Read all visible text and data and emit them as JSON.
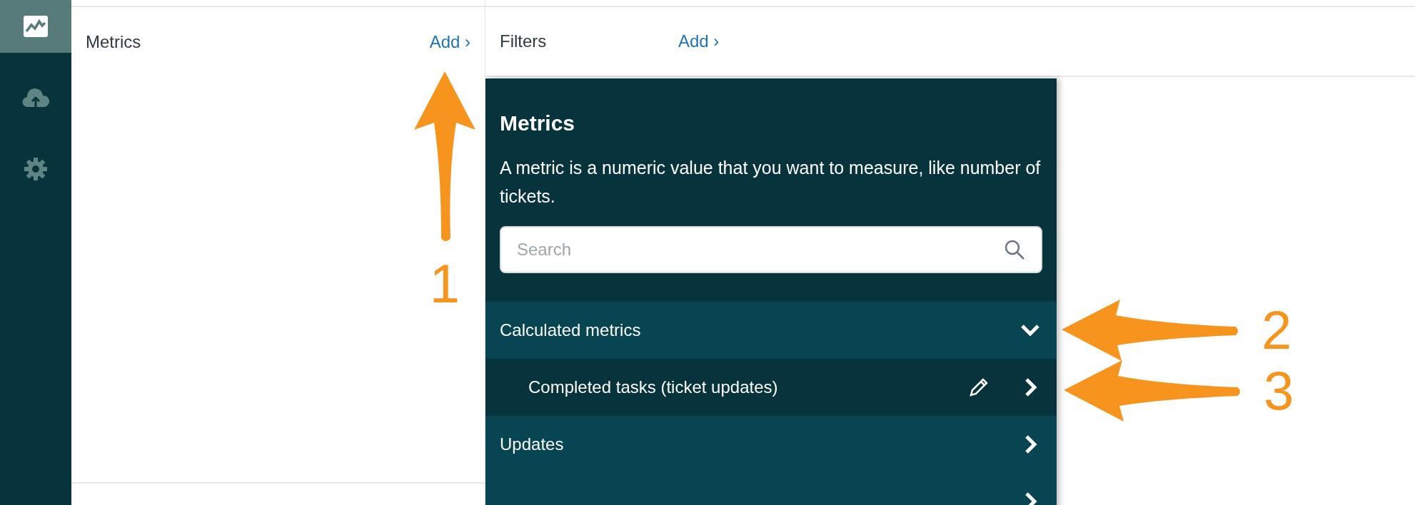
{
  "sidebar": {
    "items": [
      {
        "kind": "chart",
        "selected": true
      },
      {
        "kind": "upload",
        "selected": false
      },
      {
        "kind": "settings",
        "selected": false
      }
    ]
  },
  "metrics_panel": {
    "label": "Metrics",
    "add_link": "Add ›"
  },
  "filters_panel": {
    "label": "Filters",
    "add_link": "Add ›"
  },
  "dropdown": {
    "title": "Metrics",
    "description": "A metric is a numeric value that you want to measure, like number of tickets.",
    "search": {
      "placeholder": "Search"
    },
    "items": [
      {
        "kind": "category",
        "label": "Calculated metrics",
        "expanded": true,
        "children": [
          {
            "kind": "metric",
            "label": "Completed tasks (ticket updates)",
            "editable": true
          }
        ]
      },
      {
        "kind": "category",
        "label": "Updates",
        "expanded": false
      },
      {
        "kind": "category",
        "expanded": false
      }
    ]
  },
  "annotations": [
    {
      "label": "1",
      "kind": "up"
    },
    {
      "label": "2",
      "kind": "left"
    },
    {
      "label": "3",
      "kind": "left"
    }
  ]
}
